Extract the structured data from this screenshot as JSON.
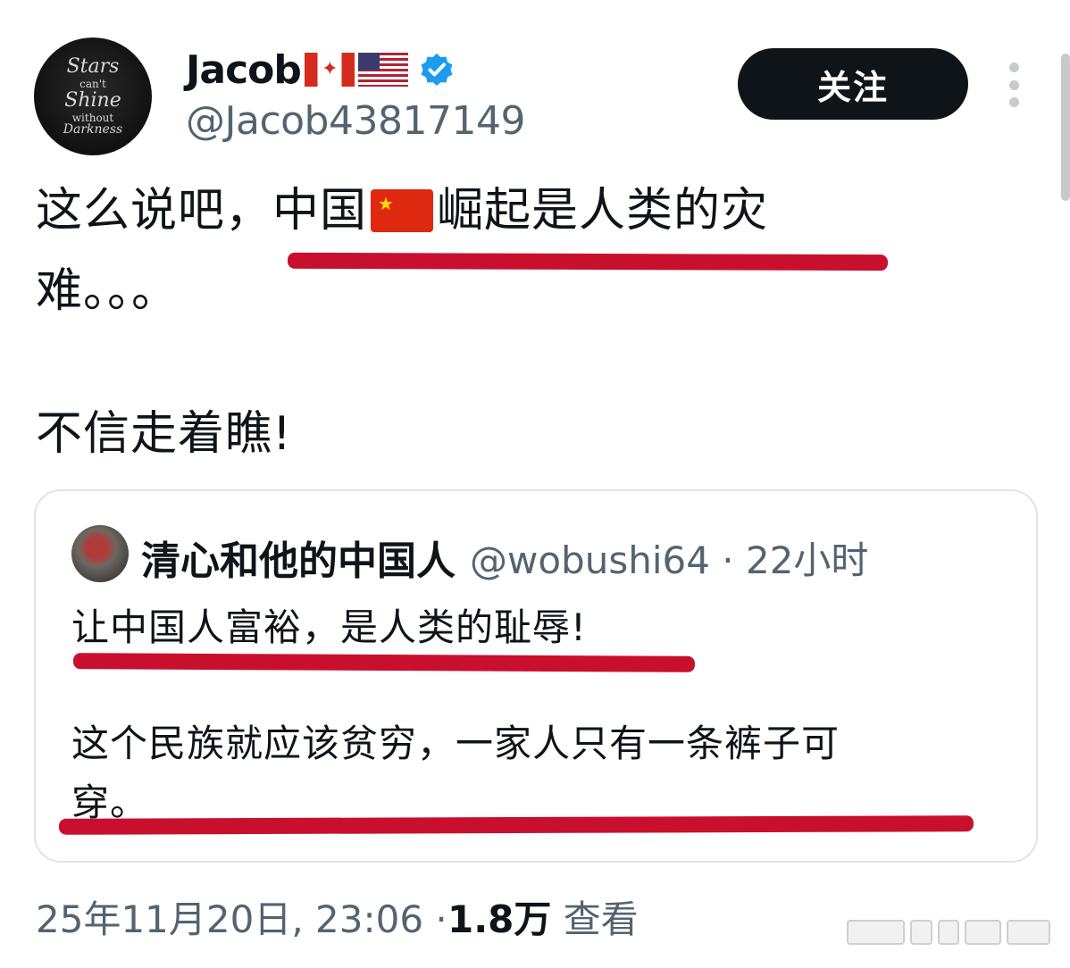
{
  "author": {
    "avatar_text": [
      "Stars",
      "can't",
      "Shine",
      "without",
      "Darkness"
    ],
    "display_name": "Jacob",
    "flags": [
      "canada-flag",
      "usa-flag"
    ],
    "handle": "@Jacob43817149",
    "verified": true
  },
  "actions": {
    "follow_label": "关注"
  },
  "tweet": {
    "line1_before": "这么说吧，",
    "line1_underlined_a": "中国",
    "line1_underlined_b": "崛起是人类的灾",
    "line2": "难。。。",
    "line3": "不信走着瞧!"
  },
  "quote": {
    "name": "清心和他的中国人",
    "meta": "@wobushi64 · 22小时",
    "line1": "让中国人富裕，是人类的耻辱!",
    "line2": "这个民族就应该贫穷，一家人只有一条裤子可",
    "line3": "穿。"
  },
  "footer": {
    "timestamp": "25年11月20日, 23:06 · ",
    "views_count": "1.8万",
    "views_label": " 查看"
  },
  "colors": {
    "accent_verified": "#1d9bf0",
    "underline": "#c8102e",
    "secondary_text": "#536471",
    "primary_text": "#0f1419"
  }
}
